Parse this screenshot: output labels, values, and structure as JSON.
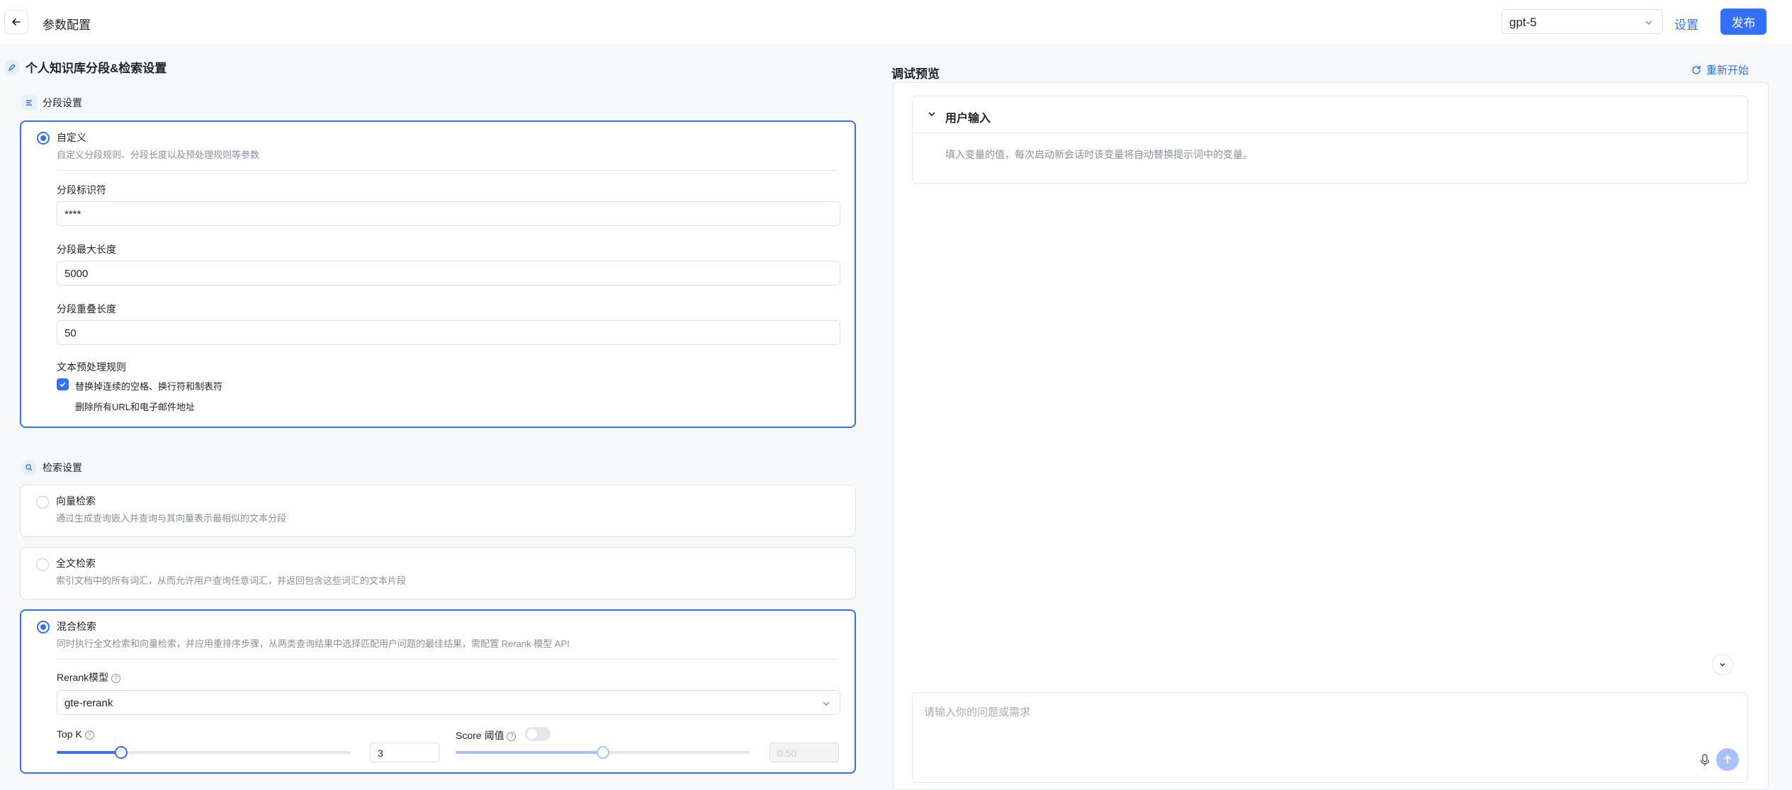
{
  "header": {
    "title": "参数配置",
    "model": "gpt-5",
    "settings_label": "设置",
    "publish_label": "发布"
  },
  "left": {
    "section_title": "个人知识库分段&检索设置",
    "chunking": {
      "title": "分段设置",
      "custom": {
        "title": "自定义",
        "desc": "自定义分段规则、分段长度以及预处理规则等参数"
      },
      "separator_label": "分段标识符",
      "separator_value": "****",
      "max_length_label": "分段最大长度",
      "max_length_value": "5000",
      "overlap_label": "分段重叠长度",
      "overlap_value": "50",
      "preprocess_label": "文本预处理规则",
      "rule1": "替换掉连续的空格、换行符和制表符",
      "rule1_checked": true,
      "rule2": "删除所有URL和电子邮件地址",
      "rule2_checked": false
    },
    "retrieval": {
      "title": "检索设置",
      "vector": {
        "title": "向量检索",
        "desc": "通过生成查询嵌入并查询与其向量表示最相似的文本分段"
      },
      "fulltext": {
        "title": "全文检索",
        "desc": "索引文档中的所有词汇，从而允许用户查询任意词汇，并返回包含这些词汇的文本片段"
      },
      "hybrid": {
        "title": "混合检索",
        "desc": "同时执行全文检索和向量检索，并应用重排序步骤，从两类查询结果中选择匹配用户问题的最佳结果，需配置 Rerank 模型 API"
      },
      "rerank_label": "Rerank模型",
      "rerank_value": "gte-rerank",
      "topk_label": "Top K",
      "topk_value": "3",
      "topk_fraction": 0.22,
      "score_label": "Score 阈值",
      "score_enabled": false,
      "score_value": "0.50",
      "score_fraction": 0.5
    }
  },
  "right": {
    "title": "调试预览",
    "restart_label": "重新开始",
    "user_input_title": "用户输入",
    "user_input_desc": "填入变量的值，每次启动新会话时该变量将自动替换提示词中的变量。",
    "chat_placeholder": "请输入你的问题或需求"
  },
  "colors": {
    "accent": "#3370ff",
    "muted_accent": "#a9c1ff",
    "border": "#dcdfe6",
    "text_secondary": "#86909c"
  },
  "icons": {
    "back": "arrow-left-icon",
    "chevron": "chevron-down-icon",
    "edit": "edit-pencil-icon",
    "chunk": "list-lines-icon",
    "retrieval": "search-icon",
    "restart": "refresh-icon",
    "mic": "microphone-icon",
    "send": "arrow-up-icon"
  }
}
